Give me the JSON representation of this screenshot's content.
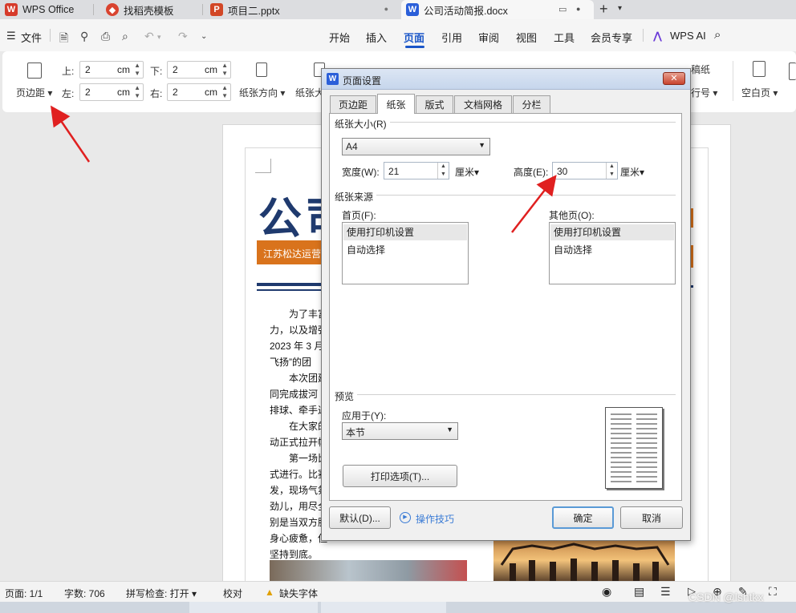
{
  "tabs": [
    {
      "label": "WPS Office",
      "icon": "wps-logo-icon"
    },
    {
      "label": "找稻壳模板",
      "icon": "docer-icon"
    },
    {
      "label": "项目二.pptx",
      "icon": "ppt-icon"
    },
    {
      "label": "公司活动简报.docx",
      "icon": "word-doc-icon"
    }
  ],
  "menu": {
    "file": "文件",
    "items": [
      "开始",
      "插入",
      "页面",
      "引用",
      "审阅",
      "视图",
      "工具",
      "会员专享"
    ],
    "selected": "页面",
    "ai": "WPS AI"
  },
  "ribbon": {
    "margins_label": "页边距",
    "top_label": "上:",
    "top_value": "2",
    "top_unit": "cm",
    "bottom_label": "下:",
    "bottom_value": "2",
    "bottom_unit": "cm",
    "left_label": "左:",
    "left_value": "2",
    "left_unit": "cm",
    "right_label": "右:",
    "right_value": "2",
    "right_unit": "cm",
    "orientation_label": "纸张方向",
    "size_label": "纸张大",
    "line_numbers_label": "行号",
    "blank_page_label": "空白页",
    "draft_label": "稿纸"
  },
  "document": {
    "title_chars": "公司",
    "subtitle": "江苏松达运营",
    "lines": [
      "为了丰富",
      "力，以及增强",
      "2023 年 3 月",
      "飞扬”的团",
      "本次团建",
      "同完成拔河",
      "排球、牵手过",
      "在大家的",
      "动正式拉开帷",
      "第一场比",
      "式进行。比赛",
      "发，现场气氛",
      "劲儿，用尽全",
      "别是当双方胜",
      "身心疲惫，但",
      "坚持到底。"
    ]
  },
  "dialog": {
    "title": "页面设置",
    "tabs": [
      "页边距",
      "纸张",
      "版式",
      "文档网格",
      "分栏"
    ],
    "active_tab": "纸张",
    "paper_size_label": "纸张大小(R)",
    "paper_size_value": "A4",
    "width_label": "宽度(W):",
    "width_value": "21",
    "width_unit": "厘米",
    "height_label": "高度(E):",
    "height_value": "30",
    "height_unit": "厘米",
    "source_label": "纸张来源",
    "first_page_label": "首页(F):",
    "other_pages_label": "其他页(O):",
    "source_options": [
      "使用打印机设置",
      "自动选择"
    ],
    "preview_label": "预览",
    "apply_to_label": "应用于(Y):",
    "apply_to_value": "本节",
    "print_options_button": "打印选项(T)...",
    "default_button": "默认(D)...",
    "tips_link": "操作技巧",
    "ok_button": "确定",
    "cancel_button": "取消"
  },
  "status": {
    "page": "页面: 1/1",
    "words": "字数: 706",
    "spell": "拼写检查: 打开",
    "proof": "校对",
    "missing_font": "缺失字体"
  },
  "watermark": "CSDN @lshtkx",
  "colors": {
    "accent": "#1a56c8",
    "title_blue": "#1f3a6e",
    "orange": "#d9731c",
    "arrow_red": "#e02020"
  }
}
